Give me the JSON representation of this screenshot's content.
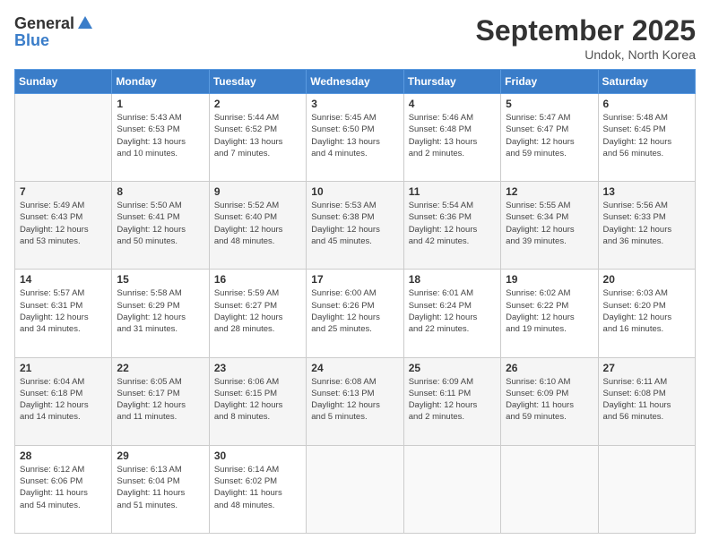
{
  "logo": {
    "general": "General",
    "blue": "Blue"
  },
  "title": "September 2025",
  "subtitle": "Undok, North Korea",
  "days_header": [
    "Sunday",
    "Monday",
    "Tuesday",
    "Wednesday",
    "Thursday",
    "Friday",
    "Saturday"
  ],
  "weeks": [
    [
      {
        "num": "",
        "info": ""
      },
      {
        "num": "1",
        "info": "Sunrise: 5:43 AM\nSunset: 6:53 PM\nDaylight: 13 hours\nand 10 minutes."
      },
      {
        "num": "2",
        "info": "Sunrise: 5:44 AM\nSunset: 6:52 PM\nDaylight: 13 hours\nand 7 minutes."
      },
      {
        "num": "3",
        "info": "Sunrise: 5:45 AM\nSunset: 6:50 PM\nDaylight: 13 hours\nand 4 minutes."
      },
      {
        "num": "4",
        "info": "Sunrise: 5:46 AM\nSunset: 6:48 PM\nDaylight: 13 hours\nand 2 minutes."
      },
      {
        "num": "5",
        "info": "Sunrise: 5:47 AM\nSunset: 6:47 PM\nDaylight: 12 hours\nand 59 minutes."
      },
      {
        "num": "6",
        "info": "Sunrise: 5:48 AM\nSunset: 6:45 PM\nDaylight: 12 hours\nand 56 minutes."
      }
    ],
    [
      {
        "num": "7",
        "info": "Sunrise: 5:49 AM\nSunset: 6:43 PM\nDaylight: 12 hours\nand 53 minutes."
      },
      {
        "num": "8",
        "info": "Sunrise: 5:50 AM\nSunset: 6:41 PM\nDaylight: 12 hours\nand 50 minutes."
      },
      {
        "num": "9",
        "info": "Sunrise: 5:52 AM\nSunset: 6:40 PM\nDaylight: 12 hours\nand 48 minutes."
      },
      {
        "num": "10",
        "info": "Sunrise: 5:53 AM\nSunset: 6:38 PM\nDaylight: 12 hours\nand 45 minutes."
      },
      {
        "num": "11",
        "info": "Sunrise: 5:54 AM\nSunset: 6:36 PM\nDaylight: 12 hours\nand 42 minutes."
      },
      {
        "num": "12",
        "info": "Sunrise: 5:55 AM\nSunset: 6:34 PM\nDaylight: 12 hours\nand 39 minutes."
      },
      {
        "num": "13",
        "info": "Sunrise: 5:56 AM\nSunset: 6:33 PM\nDaylight: 12 hours\nand 36 minutes."
      }
    ],
    [
      {
        "num": "14",
        "info": "Sunrise: 5:57 AM\nSunset: 6:31 PM\nDaylight: 12 hours\nand 34 minutes."
      },
      {
        "num": "15",
        "info": "Sunrise: 5:58 AM\nSunset: 6:29 PM\nDaylight: 12 hours\nand 31 minutes."
      },
      {
        "num": "16",
        "info": "Sunrise: 5:59 AM\nSunset: 6:27 PM\nDaylight: 12 hours\nand 28 minutes."
      },
      {
        "num": "17",
        "info": "Sunrise: 6:00 AM\nSunset: 6:26 PM\nDaylight: 12 hours\nand 25 minutes."
      },
      {
        "num": "18",
        "info": "Sunrise: 6:01 AM\nSunset: 6:24 PM\nDaylight: 12 hours\nand 22 minutes."
      },
      {
        "num": "19",
        "info": "Sunrise: 6:02 AM\nSunset: 6:22 PM\nDaylight: 12 hours\nand 19 minutes."
      },
      {
        "num": "20",
        "info": "Sunrise: 6:03 AM\nSunset: 6:20 PM\nDaylight: 12 hours\nand 16 minutes."
      }
    ],
    [
      {
        "num": "21",
        "info": "Sunrise: 6:04 AM\nSunset: 6:18 PM\nDaylight: 12 hours\nand 14 minutes."
      },
      {
        "num": "22",
        "info": "Sunrise: 6:05 AM\nSunset: 6:17 PM\nDaylight: 12 hours\nand 11 minutes."
      },
      {
        "num": "23",
        "info": "Sunrise: 6:06 AM\nSunset: 6:15 PM\nDaylight: 12 hours\nand 8 minutes."
      },
      {
        "num": "24",
        "info": "Sunrise: 6:08 AM\nSunset: 6:13 PM\nDaylight: 12 hours\nand 5 minutes."
      },
      {
        "num": "25",
        "info": "Sunrise: 6:09 AM\nSunset: 6:11 PM\nDaylight: 12 hours\nand 2 minutes."
      },
      {
        "num": "26",
        "info": "Sunrise: 6:10 AM\nSunset: 6:09 PM\nDaylight: 11 hours\nand 59 minutes."
      },
      {
        "num": "27",
        "info": "Sunrise: 6:11 AM\nSunset: 6:08 PM\nDaylight: 11 hours\nand 56 minutes."
      }
    ],
    [
      {
        "num": "28",
        "info": "Sunrise: 6:12 AM\nSunset: 6:06 PM\nDaylight: 11 hours\nand 54 minutes."
      },
      {
        "num": "29",
        "info": "Sunrise: 6:13 AM\nSunset: 6:04 PM\nDaylight: 11 hours\nand 51 minutes."
      },
      {
        "num": "30",
        "info": "Sunrise: 6:14 AM\nSunset: 6:02 PM\nDaylight: 11 hours\nand 48 minutes."
      },
      {
        "num": "",
        "info": ""
      },
      {
        "num": "",
        "info": ""
      },
      {
        "num": "",
        "info": ""
      },
      {
        "num": "",
        "info": ""
      }
    ]
  ]
}
